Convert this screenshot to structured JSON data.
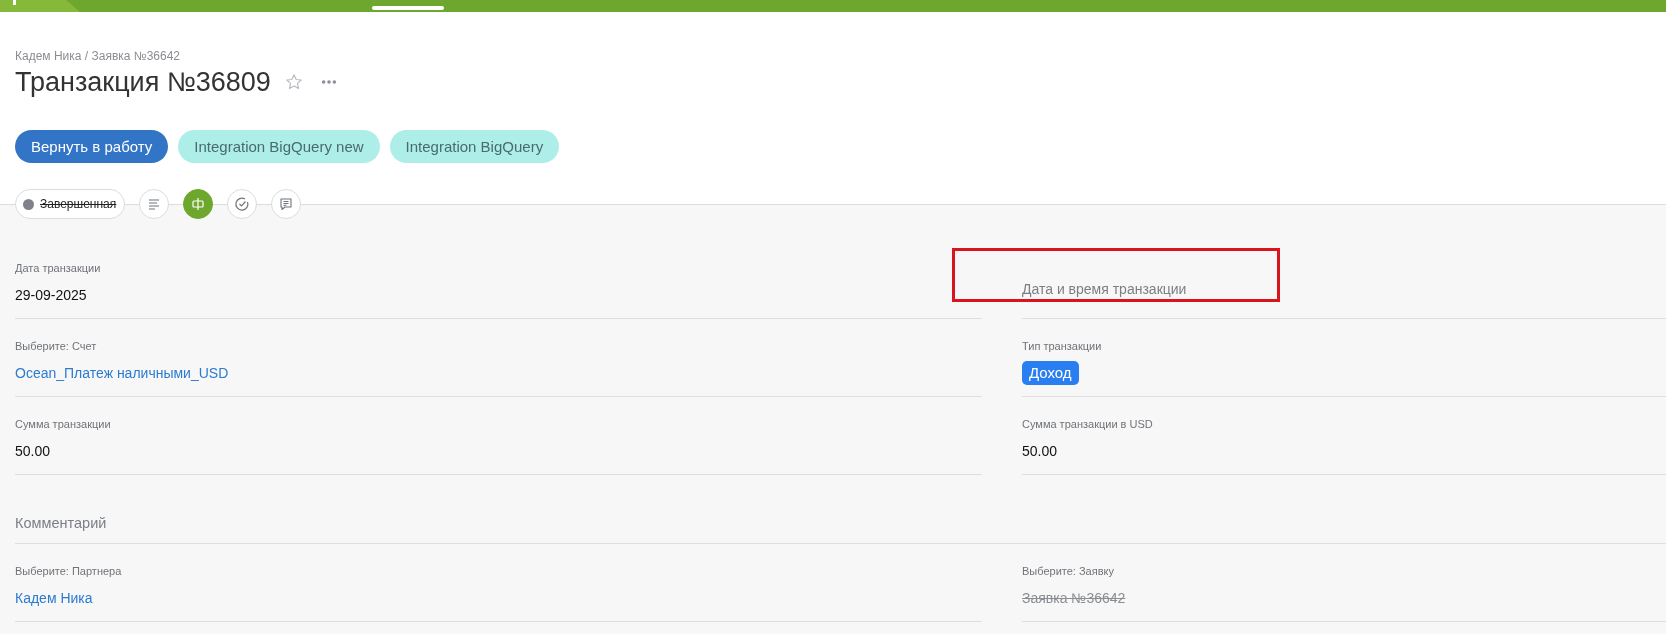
{
  "breadcrumb": "Кадем Ника / Заявка №36642",
  "title": "Транзакция №36809",
  "favorite": false,
  "actions": [
    {
      "label": "Вернуть в работу",
      "kind": "primary"
    },
    {
      "label": "Integration BigQuery new",
      "kind": "secondary"
    },
    {
      "label": "Integration BigQuery",
      "kind": "secondary"
    }
  ],
  "status": {
    "label": "Завершенная",
    "color": "#7f828a",
    "struck": true
  },
  "tabs": [
    {
      "kind": "description",
      "selected": false
    },
    {
      "kind": "fields",
      "selected": true
    },
    {
      "kind": "tasks",
      "selected": false
    },
    {
      "kind": "comments",
      "selected": false
    }
  ],
  "rows": [
    {
      "kind": "pair",
      "cells": [
        {
          "label": "Дата транзакции",
          "value": "29-09-2025",
          "kind": "text"
        },
        {
          "label": "Дата и время транзакции",
          "kind": "empty",
          "highlighted": true
        }
      ]
    },
    {
      "kind": "pair",
      "cells": [
        {
          "label": "Выберите: Счет",
          "value": "Ocean_Платеж наличными_USD",
          "kind": "link"
        },
        {
          "label": "Тип транзакции",
          "value": "Доход",
          "kind": "badge"
        }
      ]
    },
    {
      "kind": "pair",
      "cells": [
        {
          "label": "Сумма транзакции",
          "value": "50.00",
          "kind": "text"
        },
        {
          "label": "Сумма транзакции в USD",
          "value": "50.00",
          "kind": "text"
        }
      ]
    },
    {
      "kind": "section",
      "label": "Комментарий"
    },
    {
      "kind": "pair",
      "cells": [
        {
          "label": "Выберите: Партнера",
          "value": "Кадем Ника",
          "kind": "link"
        },
        {
          "label": "Выберите: Заявку",
          "value": "Заявка №36642",
          "kind": "struck"
        }
      ]
    }
  ]
}
